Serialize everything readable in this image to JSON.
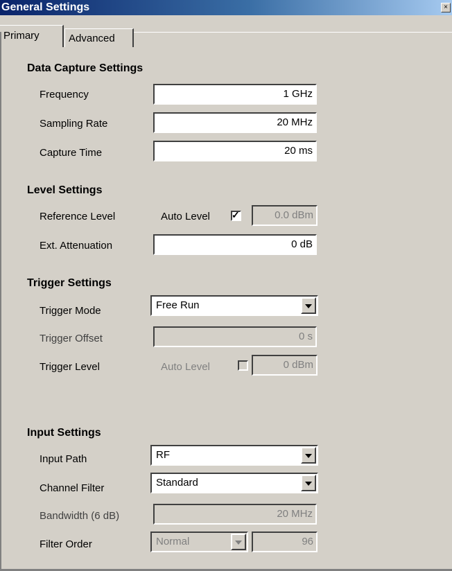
{
  "window": {
    "title": "General Settings",
    "close_glyph": "×"
  },
  "tabs": [
    {
      "label": "Primary"
    },
    {
      "label": "Advanced"
    }
  ],
  "data_capture": {
    "heading": "Data Capture Settings",
    "frequency": {
      "label": "Frequency",
      "value": "1 GHz"
    },
    "sampling_rate": {
      "label": "Sampling Rate",
      "value": "20 MHz"
    },
    "capture_time": {
      "label": "Capture Time",
      "value": "20 ms"
    }
  },
  "level": {
    "heading": "Level Settings",
    "reference_level": {
      "label": "Reference Level",
      "auto_label": "Auto Level",
      "auto_checked": true,
      "value": "0.0 dBm"
    },
    "ext_attenuation": {
      "label": "Ext. Attenuation",
      "value": "0 dB"
    }
  },
  "trigger": {
    "heading": "Trigger Settings",
    "mode": {
      "label": "Trigger Mode",
      "value": "Free Run"
    },
    "offset": {
      "label": "Trigger Offset",
      "value": "0 s"
    },
    "level": {
      "label": "Trigger Level",
      "auto_label": "Auto Level",
      "auto_checked": false,
      "value": "0 dBm"
    }
  },
  "input": {
    "heading": "Input Settings",
    "path": {
      "label": "Input Path",
      "value": "RF"
    },
    "channel_filter": {
      "label": "Channel Filter",
      "value": "Standard"
    },
    "bandwidth": {
      "label": "Bandwidth (6 dB)",
      "value": "20 MHz"
    },
    "filter_order": {
      "label": "Filter Order",
      "type_value": "Normal",
      "value": "96"
    }
  },
  "colors": {
    "face": "#d4d0c8",
    "title_start": "#0a246a",
    "disabled_text": "#808080"
  }
}
